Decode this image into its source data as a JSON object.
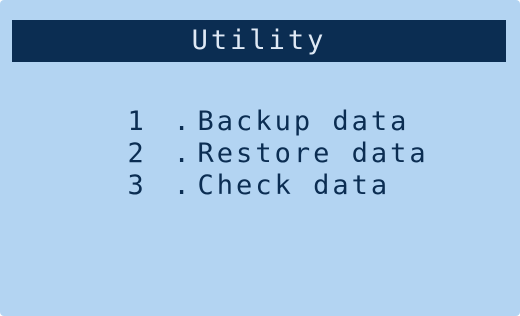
{
  "colors": {
    "screen_background": "#b3d4f2",
    "title_background": "#0b2d52",
    "title_text": "#dfe9f5",
    "menu_text": "#0b2d52"
  },
  "screen": {
    "title": "Utility",
    "menu": [
      {
        "number": "1",
        "separator": ".",
        "label": "Backup data"
      },
      {
        "number": "2",
        "separator": ".",
        "label": "Restore data"
      },
      {
        "number": "3",
        "separator": ".",
        "label": "Check data"
      }
    ]
  }
}
